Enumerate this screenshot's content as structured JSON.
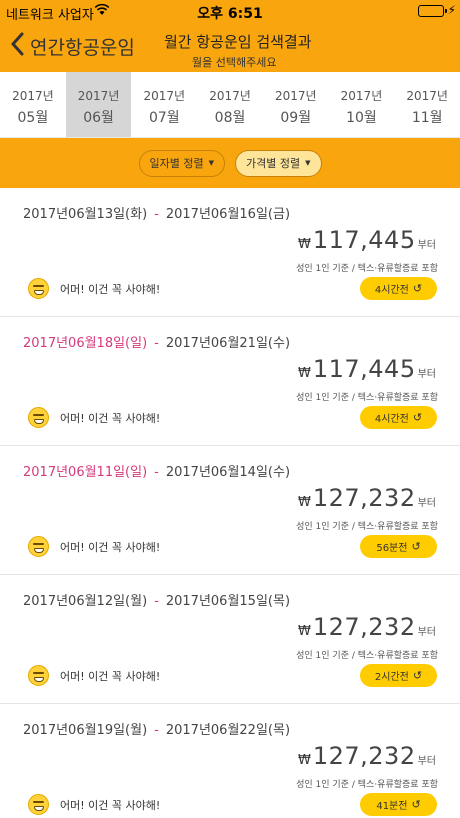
{
  "status_bar": {
    "carrier": "네트워크 사업자",
    "time": "오후 6:51",
    "wifi_icon": "wifi-icon",
    "battery_icon": "battery-icon"
  },
  "nav": {
    "back_label": "연간항공운임",
    "title": "월간 항공운임 검색결과",
    "subtitle": "월을 선택해주세요"
  },
  "months": [
    {
      "year": "2017년",
      "month": "05월"
    },
    {
      "year": "2017년",
      "month": "06월",
      "selected": true
    },
    {
      "year": "2017년",
      "month": "07월"
    },
    {
      "year": "2017년",
      "month": "08월"
    },
    {
      "year": "2017년",
      "month": "09월"
    },
    {
      "year": "2017년",
      "month": "10월"
    },
    {
      "year": "2017년",
      "month": "11월"
    }
  ],
  "sort": {
    "by_date": "일자별 정렬",
    "by_price": "가격별 정렬",
    "selected": "by_price"
  },
  "results": [
    {
      "depart": "2017년06월13일(화)",
      "depart_weekend": false,
      "return": "2017년06월16일(금)",
      "currency": "₩",
      "price": "117,445",
      "price_suffix": "부터",
      "note": "성인 1인 기준 / 텍스·유류할증료 포함",
      "message": "어머! 이건 꼭 사야해!",
      "updated": "4시간전",
      "refresh_icon": "refresh-icon"
    },
    {
      "depart": "2017년06월18일(일)",
      "depart_weekend": true,
      "return": "2017년06월21일(수)",
      "currency": "₩",
      "price": "117,445",
      "price_suffix": "부터",
      "note": "성인 1인 기준 / 텍스·유류할증료 포함",
      "message": "어머! 이건 꼭 사야해!",
      "updated": "4시간전",
      "refresh_icon": "refresh-icon"
    },
    {
      "depart": "2017년06월11일(일)",
      "depart_weekend": true,
      "return": "2017년06월14일(수)",
      "currency": "₩",
      "price": "127,232",
      "price_suffix": "부터",
      "note": "성인 1인 기준 / 텍스·유류할증료 포함",
      "message": "어머! 이건 꼭 사야해!",
      "updated": "56분전",
      "refresh_icon": "refresh-icon"
    },
    {
      "depart": "2017년06월12일(월)",
      "depart_weekend": false,
      "return": "2017년06월15일(목)",
      "currency": "₩",
      "price": "127,232",
      "price_suffix": "부터",
      "note": "성인 1인 기준 / 텍스·유류할증료 포함",
      "message": "어머! 이건 꼭 사야해!",
      "updated": "2시간전",
      "refresh_icon": "refresh-icon"
    },
    {
      "depart": "2017년06월19일(월)",
      "depart_weekend": false,
      "return": "2017년06월22일(목)",
      "currency": "₩",
      "price": "127,232",
      "price_suffix": "부터",
      "note": "성인 1인 기준 / 텍스·유류할증료 포함",
      "message": "어머! 이건 꼭 사야해!",
      "updated": "41분전",
      "refresh_icon": "refresh-icon"
    }
  ],
  "colors": {
    "accent": "#f9a50e",
    "badge": "#ffcc00",
    "weekend": "#d63a7d",
    "selected_month": "#d6d6d6"
  }
}
